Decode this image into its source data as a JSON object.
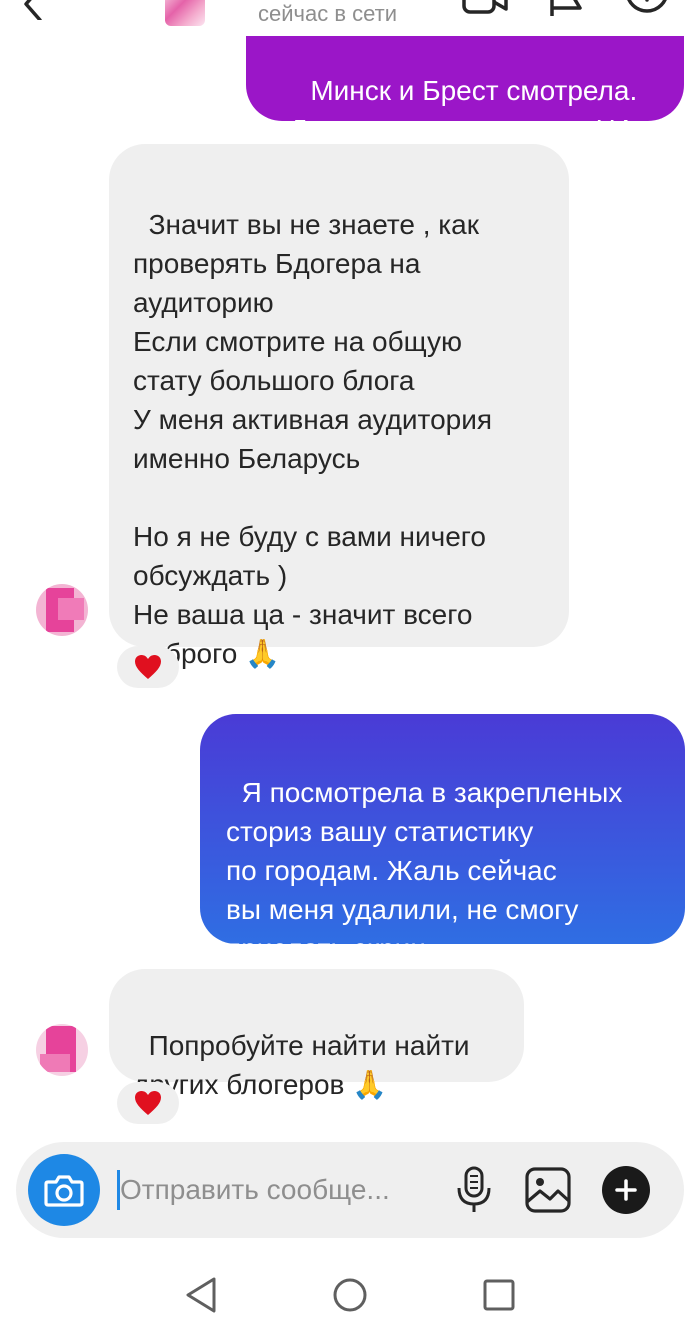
{
  "header": {
    "status": "сейчас в сети"
  },
  "messages": [
    {
      "id": "m0",
      "direction": "outgoing",
      "text": "Минск и Брест смотрела.\nДругие города - не моя ЦА."
    },
    {
      "id": "m1",
      "direction": "incoming",
      "text": "Значит вы не знаете , как\nпроверять Бдогера на\nаудиторию\nЕсли смотрите на общую\nстату большого блога\nУ меня активная аудитория\nименно Беларусь\n\nНо я не буду с вами ничего\nобсуждать )\nНе ваша ца - значит всего\nдоброго 🙏",
      "reaction": "heart"
    },
    {
      "id": "m2",
      "direction": "outgoing",
      "text": "Я посмотрела в закрепленых\nсториз вашу статистику\nпо городам. Жаль сейчас\nвы меня удалили, не смогу\nприслать скрин."
    },
    {
      "id": "m3",
      "direction": "incoming",
      "text": "Попробуйте найти найти\nдругих блогеров 🙏",
      "reaction": "heart"
    }
  ],
  "composer": {
    "placeholder": "Отправить сообще..."
  },
  "icons": {
    "camera": "camera-icon",
    "mic": "microphone-icon",
    "gallery": "gallery-icon",
    "plus": "plus-icon",
    "reaction": "heart-icon",
    "emoji": "folded-hands"
  },
  "colors": {
    "incoming_bubble": "#efefef",
    "outgoing_purple": "#9b16c8",
    "outgoing_blue_top": "#4a3bd6",
    "outgoing_blue_bottom": "#2f6ee3",
    "heart": "#e0101f",
    "accent_blue": "#1e88e5"
  }
}
